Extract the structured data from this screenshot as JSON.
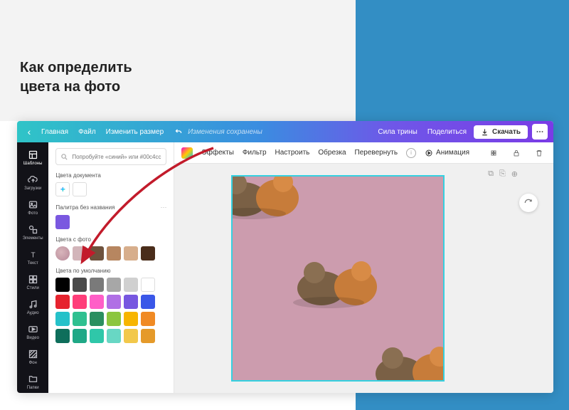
{
  "title_line1": "Как определить",
  "title_line2": "цвета на фото",
  "topbar": {
    "home": "Главная",
    "file": "Файл",
    "resize": "Изменить размер",
    "status": "Изменения сохранены",
    "team": "Сила трины",
    "share": "Поделиться",
    "download": "Скачать"
  },
  "rail": {
    "items": [
      {
        "label": "Шаблоны"
      },
      {
        "label": "Загрузки"
      },
      {
        "label": "Фото"
      },
      {
        "label": "Элементы"
      },
      {
        "label": "Текст"
      },
      {
        "label": "Стили"
      },
      {
        "label": "Аудио"
      },
      {
        "label": "Видео"
      },
      {
        "label": "Фон"
      },
      {
        "label": "Папки"
      }
    ]
  },
  "search": {
    "placeholder": "Попробуйте «синий» или #00c4cc"
  },
  "sections": {
    "doc": "Цвета документа",
    "palette": "Палитра без названия",
    "photo": "Цвета с фото",
    "default": "Цвета по умолчанию"
  },
  "colors": {
    "palette": [
      "#7a58e0"
    ],
    "photo": [
      "#cc9cae",
      "#d2b5ba",
      "#6e523d",
      "#b78660",
      "#d7ae8c",
      "#4a2d1b"
    ],
    "default": [
      "#000000",
      "#4a4a4a",
      "#7a7a7a",
      "#a7a7a7",
      "#d0d0d0",
      "#ffffff",
      "#e6242f",
      "#ff3e7a",
      "#ff5ec7",
      "#b06fe5",
      "#7757e0",
      "#3a57e8",
      "#25c1c9",
      "#2fc090",
      "#2a8f60",
      "#8cc63f",
      "#f7b500",
      "#f08a24",
      "#0e6e5b",
      "#1fa886",
      "#2fc7a9",
      "#68d7c4",
      "#f2c84b",
      "#e59a2a"
    ]
  },
  "canvas_toolbar": {
    "effects": "Эффекты",
    "filter": "Фильтр",
    "adjust": "Настроить",
    "crop": "Обрезка",
    "flip": "Перевернуть",
    "animation": "Анимация"
  }
}
